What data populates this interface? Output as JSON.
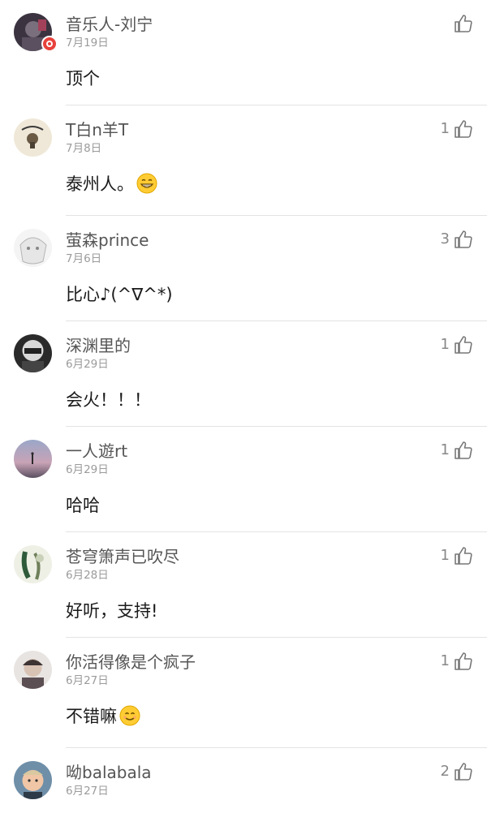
{
  "comments": [
    {
      "username": "音乐人-刘宁",
      "date": "7月19日",
      "likes": "",
      "text": "顶个",
      "emoji": "",
      "verified": true
    },
    {
      "username": "T白n羊T",
      "date": "7月8日",
      "likes": "1",
      "text": "泰州人。",
      "emoji": "grin-emoji"
    },
    {
      "username": "萤森prince",
      "date": "7月6日",
      "likes": "3",
      "text": "比心♪(^∇^*)",
      "emoji": ""
    },
    {
      "username": "深渊里的",
      "date": "6月29日",
      "likes": "1",
      "text": "会火！！！",
      "emoji": ""
    },
    {
      "username": "一人遊rt",
      "date": "6月29日",
      "likes": "1",
      "text": "哈哈",
      "emoji": ""
    },
    {
      "username": "苍穹箫声已吹尽",
      "date": "6月28日",
      "likes": "1",
      "text": "好听，支持!",
      "emoji": ""
    },
    {
      "username": "你活得像是个疯子",
      "date": "6月27日",
      "likes": "1",
      "text": "不错嘛",
      "emoji": "smile-emoji"
    },
    {
      "username": "呦balabala",
      "date": "6月27日",
      "likes": "2",
      "text": "",
      "emoji": ""
    }
  ],
  "icons": {
    "like": "thumbs-up-icon",
    "verified": "verified-badge-icon"
  }
}
